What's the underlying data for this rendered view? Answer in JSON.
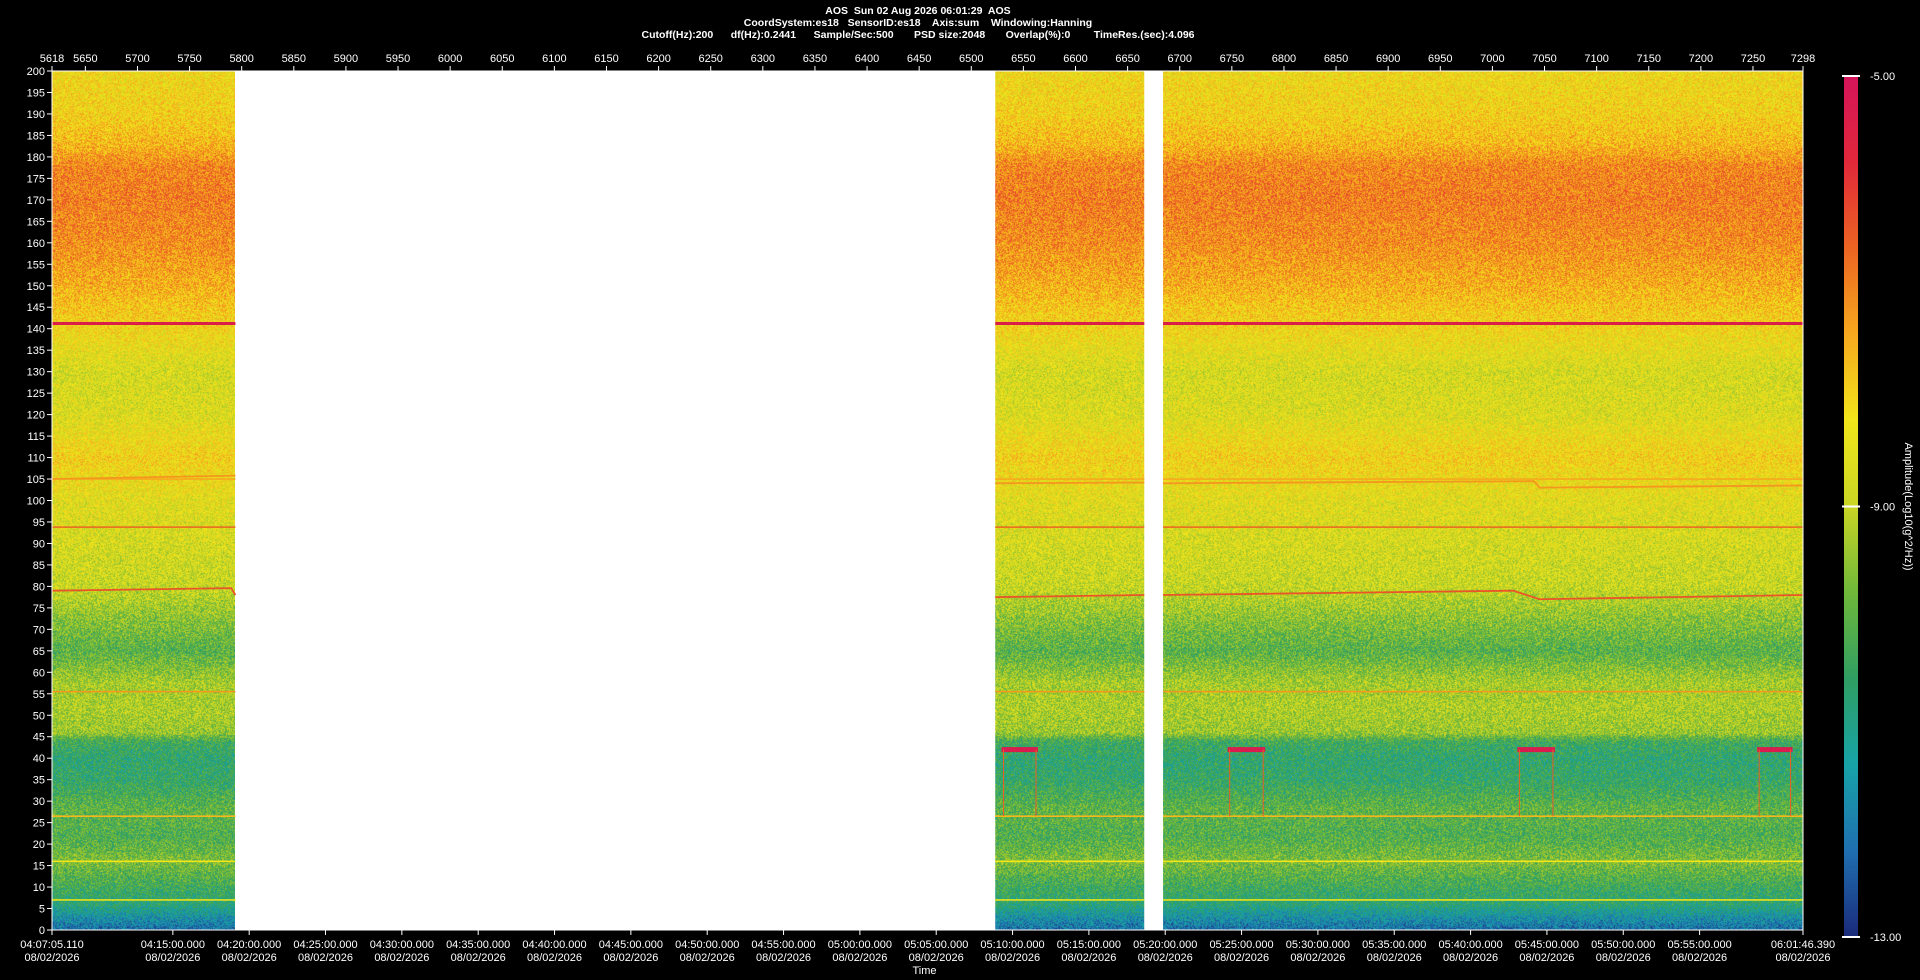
{
  "header": {
    "line1": "AOS  Sun 02 Aug 2026 06:01:29  AOS",
    "line2": "CoordSystem:es18   SensorID:es18    Axis:sum    Windowing:Hanning",
    "line3": "Cutoff(Hz):200      df(Hz):0.2441      Sample/Sec:500       PSD size:2048       Overlap(%):0        TimeRes.(sec):4.096"
  },
  "chart_data": {
    "type": "heatmap",
    "title": "AOS  Sun 02 Aug 2026 06:01:29  AOS",
    "xlabel": "Time",
    "ylabel": "",
    "colorbar_label": "Amplitude(Log10(g^2/Hz))",
    "ylim": [
      0,
      200
    ],
    "y_ticks": [
      0,
      5,
      10,
      15,
      20,
      25,
      30,
      35,
      40,
      45,
      50,
      55,
      60,
      65,
      70,
      75,
      80,
      85,
      90,
      95,
      100,
      105,
      110,
      115,
      120,
      125,
      130,
      135,
      140,
      145,
      150,
      155,
      160,
      165,
      170,
      175,
      180,
      185,
      190,
      195,
      200
    ],
    "top_axis_range": [
      5618,
      7298
    ],
    "top_ticks": [
      "5618",
      "5650",
      "5700",
      "5750",
      "5800",
      "5850",
      "5900",
      "5950",
      "6000",
      "6050",
      "6100",
      "6150",
      "6200",
      "6250",
      "6300",
      "6350",
      "6400",
      "6450",
      "6500",
      "6550",
      "6600",
      "6650",
      "6700",
      "6750",
      "6800",
      "6850",
      "6900",
      "6950",
      "7000",
      "7050",
      "7100",
      "7150",
      "7200",
      "7250",
      "7298"
    ],
    "time_range": [
      "04:07:05.110",
      "06:01:46.390"
    ],
    "time_ticks": [
      {
        "time": "04:07:05.110",
        "date": "08/02/2026"
      },
      {
        "time": "04:15:00.000",
        "date": "08/02/2026"
      },
      {
        "time": "04:20:00.000",
        "date": "08/02/2026"
      },
      {
        "time": "04:25:00.000",
        "date": "08/02/2026"
      },
      {
        "time": "04:30:00.000",
        "date": "08/02/2026"
      },
      {
        "time": "04:35:00.000",
        "date": "08/02/2026"
      },
      {
        "time": "04:40:00.000",
        "date": "08/02/2026"
      },
      {
        "time": "04:45:00.000",
        "date": "08/02/2026"
      },
      {
        "time": "04:50:00.000",
        "date": "08/02/2026"
      },
      {
        "time": "04:55:00.000",
        "date": "08/02/2026"
      },
      {
        "time": "05:00:00.000",
        "date": "08/02/2026"
      },
      {
        "time": "05:05:00.000",
        "date": "08/02/2026"
      },
      {
        "time": "05:10:00.000",
        "date": "08/02/2026"
      },
      {
        "time": "05:15:00.000",
        "date": "08/02/2026"
      },
      {
        "time": "05:20:00.000",
        "date": "08/02/2026"
      },
      {
        "time": "05:25:00.000",
        "date": "08/02/2026"
      },
      {
        "time": "05:30:00.000",
        "date": "08/02/2026"
      },
      {
        "time": "05:35:00.000",
        "date": "08/02/2026"
      },
      {
        "time": "05:40:00.000",
        "date": "08/02/2026"
      },
      {
        "time": "05:45:00.000",
        "date": "08/02/2026"
      },
      {
        "time": "05:50:00.000",
        "date": "08/02/2026"
      },
      {
        "time": "05:55:00.000",
        "date": "08/02/2026"
      },
      {
        "time": "06:01:46.390",
        "date": "08/02/2026"
      }
    ],
    "data_segments": [
      {
        "start": 5618,
        "end": 5794
      },
      {
        "start": 6523,
        "end": 6666
      },
      {
        "start": 6684,
        "end": 7298
      }
    ],
    "colorbar": {
      "min": -13.0,
      "max": -5.0,
      "tick_labels": [
        "-5.00",
        "-9.00",
        "-13.00"
      ],
      "tick_values": [
        -5.0,
        -9.0,
        -13.0
      ]
    },
    "colorscale": [
      "#1a2a7a",
      "#1f6fb0",
      "#17a3a8",
      "#2f9e62",
      "#6fb83a",
      "#c9d524",
      "#f2e61a",
      "#f6a81e",
      "#ec6422",
      "#e0283a",
      "#d4145a"
    ],
    "level_profile": [
      {
        "hz": 0,
        "level": -12.2
      },
      {
        "hz": 3,
        "level": -11.6
      },
      {
        "hz": 6,
        "level": -10.8
      },
      {
        "hz": 10,
        "level": -10.4
      },
      {
        "hz": 16,
        "level": -9.7
      },
      {
        "hz": 22,
        "level": -10.2
      },
      {
        "hz": 28,
        "level": -10.0
      },
      {
        "hz": 35,
        "level": -10.6
      },
      {
        "hz": 40,
        "level": -10.7
      },
      {
        "hz": 44,
        "level": -10.4
      },
      {
        "hz": 46,
        "level": -9.4
      },
      {
        "hz": 52,
        "level": -9.2
      },
      {
        "hz": 58,
        "level": -9.3
      },
      {
        "hz": 65,
        "level": -10.1
      },
      {
        "hz": 72,
        "level": -9.6
      },
      {
        "hz": 80,
        "level": -8.9
      },
      {
        "hz": 90,
        "level": -8.7
      },
      {
        "hz": 100,
        "level": -8.5
      },
      {
        "hz": 110,
        "level": -8.0
      },
      {
        "hz": 120,
        "level": -8.6
      },
      {
        "hz": 130,
        "level": -8.7
      },
      {
        "hz": 142,
        "level": -8.0
      },
      {
        "hz": 150,
        "level": -7.5
      },
      {
        "hz": 160,
        "level": -7.1
      },
      {
        "hz": 170,
        "level": -6.9
      },
      {
        "hz": 178,
        "level": -7.0
      },
      {
        "hz": 183,
        "level": -7.6
      },
      {
        "hz": 190,
        "level": -8.0
      },
      {
        "hz": 200,
        "level": -8.2
      }
    ],
    "tonal_lines": [
      {
        "hz": 141.2,
        "level": -5.4
      },
      {
        "hz": 93.8,
        "level": -6.6
      },
      {
        "hz": 55.5,
        "level": -7.2
      },
      {
        "hz": 26.5,
        "level": -7.6
      },
      {
        "hz": 105.0,
        "level": -7.4
      },
      {
        "hz": 16.0,
        "level": -8.2
      },
      {
        "hz": 7.0,
        "level": -8.4
      }
    ],
    "drifting_lines": [
      {
        "level": -6.4,
        "points": [
          [
            5618,
            79.0
          ],
          [
            5790,
            79.6
          ],
          [
            5794,
            78.0
          ],
          [
            6523,
            77.5
          ],
          [
            6666,
            78.0
          ],
          [
            6684,
            78.0
          ],
          [
            7020,
            79.0
          ],
          [
            7045,
            77.0
          ],
          [
            7298,
            78.0
          ]
        ]
      },
      {
        "level": -7.2,
        "points": [
          [
            5618,
            105.0
          ],
          [
            5794,
            105.8
          ],
          [
            6523,
            104.0
          ],
          [
            6666,
            104.2
          ],
          [
            6684,
            104.0
          ],
          [
            7040,
            104.5
          ],
          [
            7045,
            103.0
          ],
          [
            7298,
            103.5
          ]
        ]
      }
    ],
    "burst_events": [
      {
        "start": 6529,
        "end": 6564,
        "hz": 42.0,
        "level": -5.3
      },
      {
        "start": 6746,
        "end": 6782,
        "hz": 42.0,
        "level": -5.3
      },
      {
        "start": 7024,
        "end": 7060,
        "hz": 42.0,
        "level": -5.3
      },
      {
        "start": 7254,
        "end": 7288,
        "hz": 42.0,
        "level": -5.3
      }
    ]
  }
}
